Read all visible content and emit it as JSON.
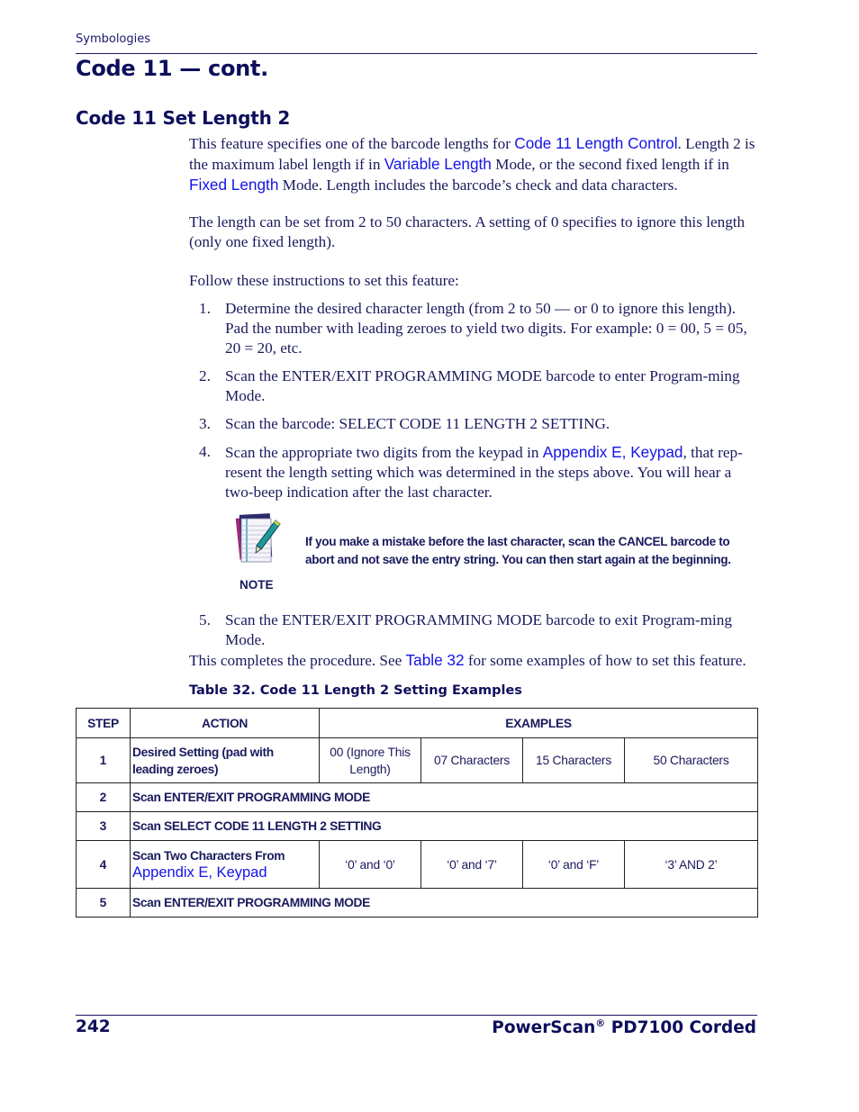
{
  "header": {
    "section": "Symbologies",
    "page_title": "Code 11 — cont.",
    "section_title": "Code 11 Set Length 2"
  },
  "intro": {
    "p1": {
      "t1": "This feature specifies one of the barcode lengths for ",
      "link1": "Code 11 Length Control",
      "t2": ". Length 2 is the maximum label length if in ",
      "link2": "Variable Length",
      "t3": " Mode, or the second fixed length if in ",
      "link3": "Fixed Length",
      "t4": " Mode. Length includes the barcode’s check and data characters."
    },
    "p2": "The length can be set from 2 to 50 characters. A setting of 0 specifies to ignore this length (only one fixed length).",
    "p3": "Follow these instructions to set this feature:"
  },
  "steps": [
    {
      "num": "1.",
      "text": "Determine the desired character length (from 2 to 50 — or 0 to ignore this length). Pad the number with leading zeroes to yield two digits. For example: 0 = 00, 5 = 05, 20 = 20, etc."
    },
    {
      "num": "2.",
      "text": "Scan the ENTER/EXIT PROGRAMMING MODE barcode to enter Program-ming Mode."
    },
    {
      "num": "3.",
      "text": "Scan the barcode: SELECT CODE 11 LENGTH 2 SETTING."
    },
    {
      "num": "4.",
      "text_before": "Scan the appropriate two digits from the keypad in ",
      "link": "Appendix E, Keypad",
      "text_after": ", that rep-resent the length setting which was determined in the steps above. You will hear a two-beep indication after the last character."
    },
    {
      "num": "5.",
      "text": "Scan the ENTER/EXIT PROGRAMMING MODE barcode to exit Program-ming Mode."
    }
  ],
  "note": {
    "icon": "notepad-pen-icon",
    "label": "NOTE",
    "text": "If you make a mistake before the last character, scan the CANCEL barcode to abort and not save the entry string. You can then start again at the beginning."
  },
  "closing": {
    "t1": "This completes the procedure. See ",
    "link": "Table 32",
    "t2": " for some examples of how to set this feature."
  },
  "table": {
    "caption": "Table 32. Code 11 Length 2 Setting Examples",
    "headers": {
      "step": "STEP",
      "action": "ACTION",
      "examples": "EXAMPLES"
    },
    "rows": [
      {
        "step": "1",
        "action": "Desired Setting (pad with leading zeroes)",
        "examples": [
          "00 (Ignore This Length)",
          "07 Characters",
          "15 Characters",
          "50 Characters"
        ]
      },
      {
        "step": "2",
        "action": "Scan ENTER/EXIT PROGRAMMING MODE"
      },
      {
        "step": "3",
        "action": "Scan SELECT CODE 11 LENGTH 2 SETTING"
      },
      {
        "step": "4",
        "action": "Scan Two Characters From",
        "action_link": "Appendix E, Keypad",
        "examples": [
          "‘0’ and ‘0’",
          "‘0’ and ‘7’",
          "‘0’ and ‘F’",
          "‘3’ AND 2’"
        ]
      },
      {
        "step": "5",
        "action": "Scan ENTER/EXIT PROGRAMMING MODE"
      }
    ]
  },
  "footer": {
    "page_number": "242",
    "product": "PowerScan",
    "product_reg": "®",
    "product_model": " PD7100 Corded"
  }
}
